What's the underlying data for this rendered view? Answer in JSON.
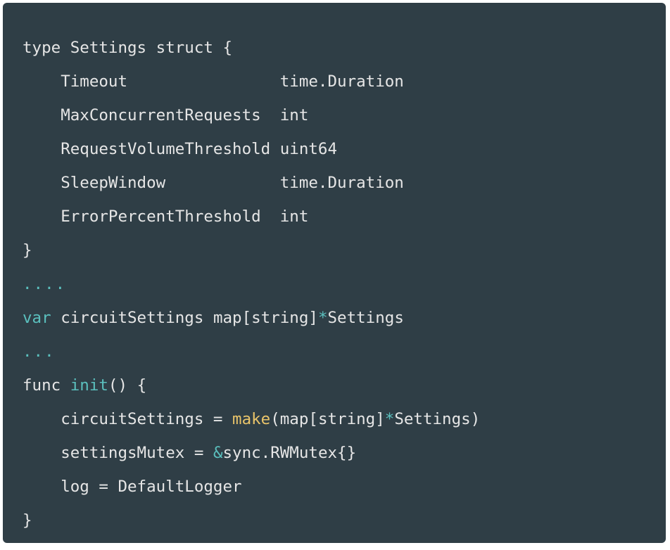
{
  "struct": {
    "decl_kw": "type",
    "name": "Settings",
    "struct_kw": "struct",
    "open": "{",
    "fields": [
      {
        "name": "Timeout",
        "type": "time.Duration"
      },
      {
        "name": "MaxConcurrentRequests",
        "type": "int"
      },
      {
        "name": "RequestVolumeThreshold",
        "type": "uint64"
      },
      {
        "name": "SleepWindow",
        "type": "time.Duration"
      },
      {
        "name": "ErrorPercentThreshold",
        "type": "int"
      }
    ],
    "close": "}"
  },
  "ellipsis1": "....",
  "var_decl": {
    "kw": "var",
    "name": "circuitSettings",
    "type_prefix": "map[string]",
    "star": "*",
    "type_suffix": "Settings"
  },
  "ellipsis2": "...",
  "func": {
    "kw": "func",
    "name": "init",
    "parens": "()",
    "open": "{",
    "body": [
      {
        "lhs": "circuitSettings",
        "eq": " = ",
        "builtin": "make",
        "args_prefix": "(map[string]",
        "star": "*",
        "args_suffix": "Settings)"
      },
      {
        "lhs": "settingsMutex",
        "eq": " = ",
        "amp": "&",
        "rhs": "sync.RWMutex{}"
      },
      {
        "lhs": "log",
        "eq": " = ",
        "rhs": "DefaultLogger"
      }
    ],
    "close": "}"
  },
  "indent": "    ",
  "field_col_width": 23
}
